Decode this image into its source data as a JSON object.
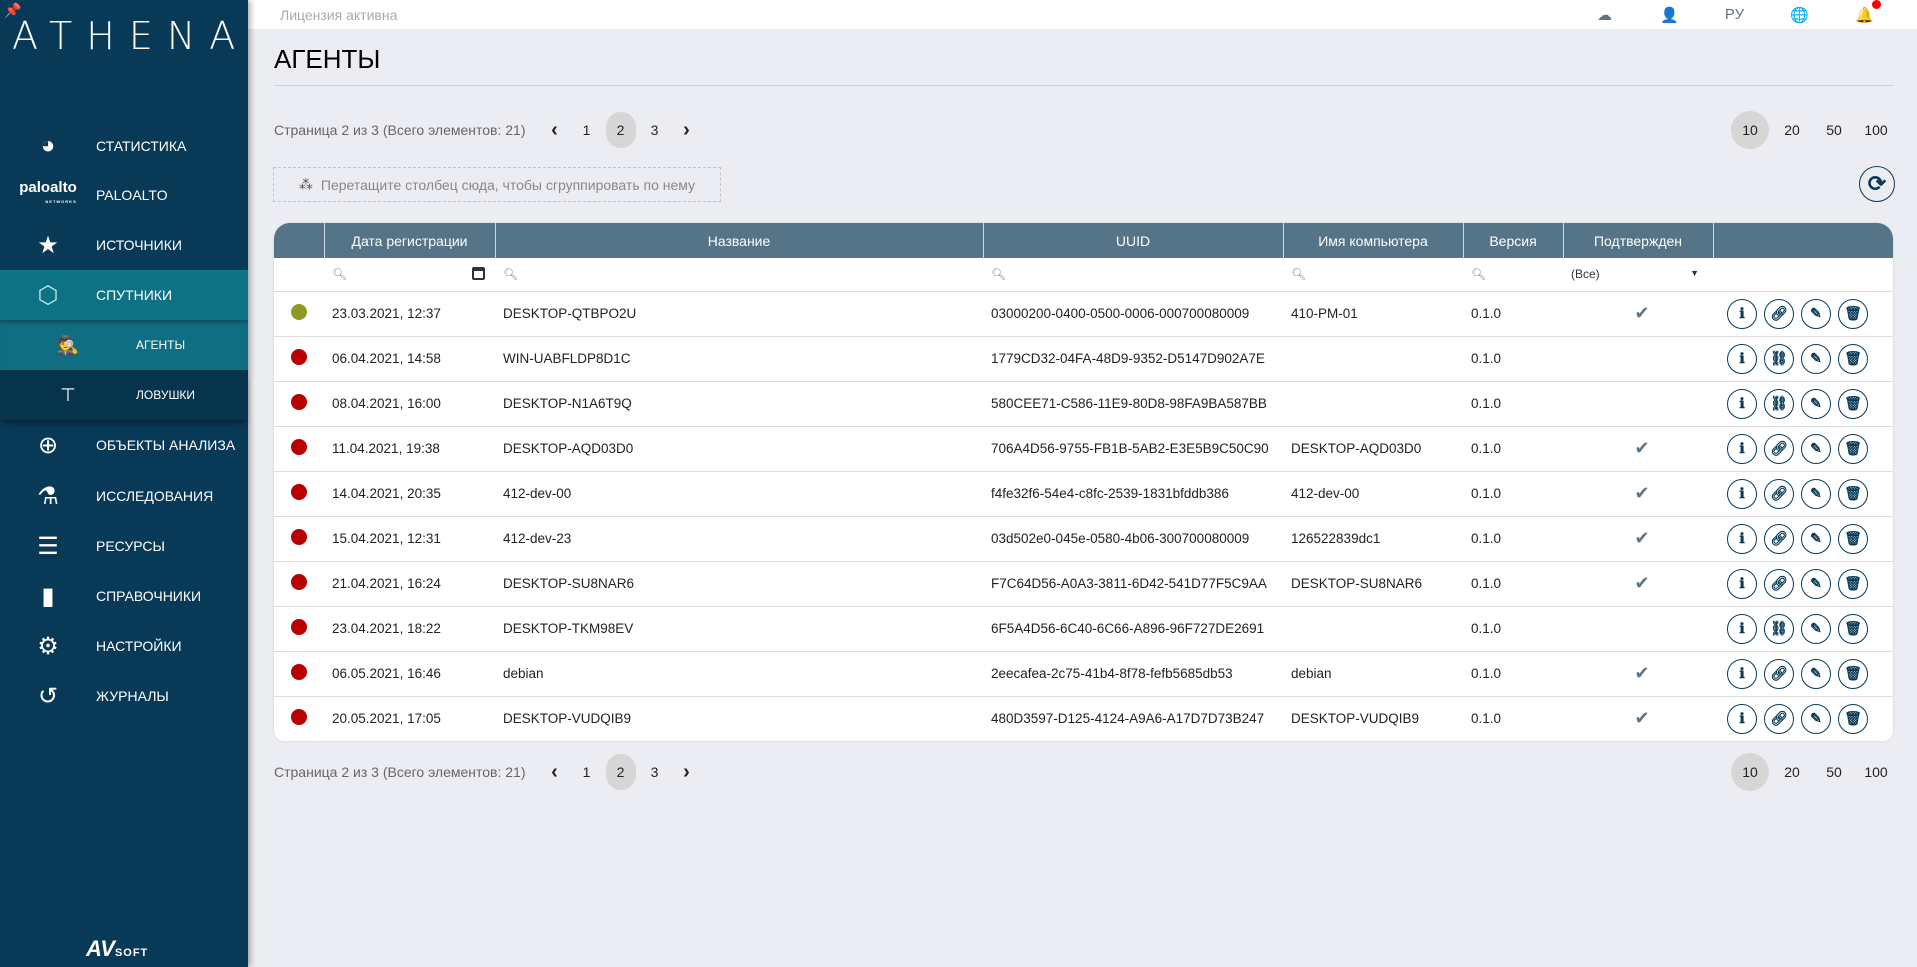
{
  "sidebar": {
    "logo": "ATHENA",
    "brand": "AVSOFT",
    "items": [
      {
        "label": "СТАТИСТИКА",
        "icon": "pie-chart-icon"
      },
      {
        "label": "PALOALTO",
        "icon": "paloalto-logo"
      },
      {
        "label": "ИСТОЧНИКИ",
        "icon": "star-icon"
      },
      {
        "label": "СПУТНИКИ",
        "icon": "satellite-icon"
      },
      {
        "label": "АГЕНТЫ",
        "icon": "spy-icon"
      },
      {
        "label": "ЛОВУШКИ",
        "icon": "signpost-icon"
      },
      {
        "label": "ОБЪЕКТЫ АНАЛИЗА",
        "icon": "crosshair-icon"
      },
      {
        "label": "ИССЛЕДОВАНИЯ",
        "icon": "flask-icon"
      },
      {
        "label": "РЕСУРСЫ",
        "icon": "server-icon"
      },
      {
        "label": "СПРАВОЧНИКИ",
        "icon": "book-icon"
      },
      {
        "label": "НАСТРОЙКИ",
        "icon": "gear-icon"
      },
      {
        "label": "ЖУРНАЛЫ",
        "icon": "history-icon"
      }
    ],
    "paloalto_logo": "paloalto",
    "paloalto_sub": "NETWORKS"
  },
  "topbar": {
    "license": "Лицензия активна",
    "lang": "РУ"
  },
  "page": {
    "title": "АГЕНТЫ"
  },
  "pager": {
    "info": "Страница 2 из 3 (Всего элементов: 21)",
    "pages": [
      "1",
      "2",
      "3"
    ],
    "current": "2",
    "sizes": [
      "10",
      "20",
      "50",
      "100"
    ],
    "current_size": "10"
  },
  "group_panel": "Перетащите столбец сюда, чтобы сгруппировать по нему",
  "table": {
    "columns": [
      "",
      "Дата регистрации",
      "Название",
      "UUID",
      "Имя компьютера",
      "Версия",
      "Подтвержден",
      ""
    ],
    "filter_all": "(Все)",
    "colors": {
      "online": "#8f9a26",
      "offline": "#b80000"
    },
    "rows": [
      {
        "status": "online",
        "date": "23.03.2021, 12:37",
        "name": "DESKTOP-QTBPO2U",
        "uuid": "03000200-0400-0500-0006-000700080009",
        "computer": "410-PM-01",
        "version": "0.1.0",
        "confirmed": true,
        "linked": true
      },
      {
        "status": "offline",
        "date": "06.04.2021, 14:58",
        "name": "WIN-UABFLDP8D1C",
        "uuid": "1779CD32-04FA-48D9-9352-D5147D902A7E",
        "computer": "",
        "version": "0.1.0",
        "confirmed": false,
        "linked": false
      },
      {
        "status": "offline",
        "date": "08.04.2021, 16:00",
        "name": "DESKTOP-N1A6T9Q",
        "uuid": "580CEE71-C586-11E9-80D8-98FA9BA587BB",
        "computer": "",
        "version": "0.1.0",
        "confirmed": false,
        "linked": false
      },
      {
        "status": "offline",
        "date": "11.04.2021, 19:38",
        "name": "DESKTOP-AQD03D0",
        "uuid": "706A4D56-9755-FB1B-5AB2-E3E5B9C50C90",
        "computer": "DESKTOP-AQD03D0",
        "version": "0.1.0",
        "confirmed": true,
        "linked": true
      },
      {
        "status": "offline",
        "date": "14.04.2021, 20:35",
        "name": "412-dev-00",
        "uuid": "f4fe32f6-54e4-c8fc-2539-1831bfddb386",
        "computer": "412-dev-00",
        "version": "0.1.0",
        "confirmed": true,
        "linked": true
      },
      {
        "status": "offline",
        "date": "15.04.2021, 12:31",
        "name": "412-dev-23",
        "uuid": "03d502e0-045e-0580-4b06-300700080009",
        "computer": "126522839dc1",
        "version": "0.1.0",
        "confirmed": true,
        "linked": true
      },
      {
        "status": "offline",
        "date": "21.04.2021, 16:24",
        "name": "DESKTOP-SU8NAR6",
        "uuid": "F7C64D56-A0A3-3811-6D42-541D77F5C9AA",
        "computer": "DESKTOP-SU8NAR6",
        "version": "0.1.0",
        "confirmed": true,
        "linked": true
      },
      {
        "status": "offline",
        "date": "23.04.2021, 18:22",
        "name": "DESKTOP-TKM98EV",
        "uuid": "6F5A4D56-6C40-6C66-A896-96F727DE2691",
        "computer": "",
        "version": "0.1.0",
        "confirmed": false,
        "linked": false
      },
      {
        "status": "offline",
        "date": "06.05.2021, 16:46",
        "name": "debian",
        "uuid": "2eecafea-2c75-41b4-8f78-fefb5685db53",
        "computer": "debian",
        "version": "0.1.0",
        "confirmed": true,
        "linked": true
      },
      {
        "status": "offline",
        "date": "20.05.2021, 17:05",
        "name": "DESKTOP-VUDQIB9",
        "uuid": "480D3597-D125-4124-A9A6-A17D7D73B247",
        "computer": "DESKTOP-VUDQIB9",
        "version": "0.1.0",
        "confirmed": true,
        "linked": true
      }
    ]
  }
}
